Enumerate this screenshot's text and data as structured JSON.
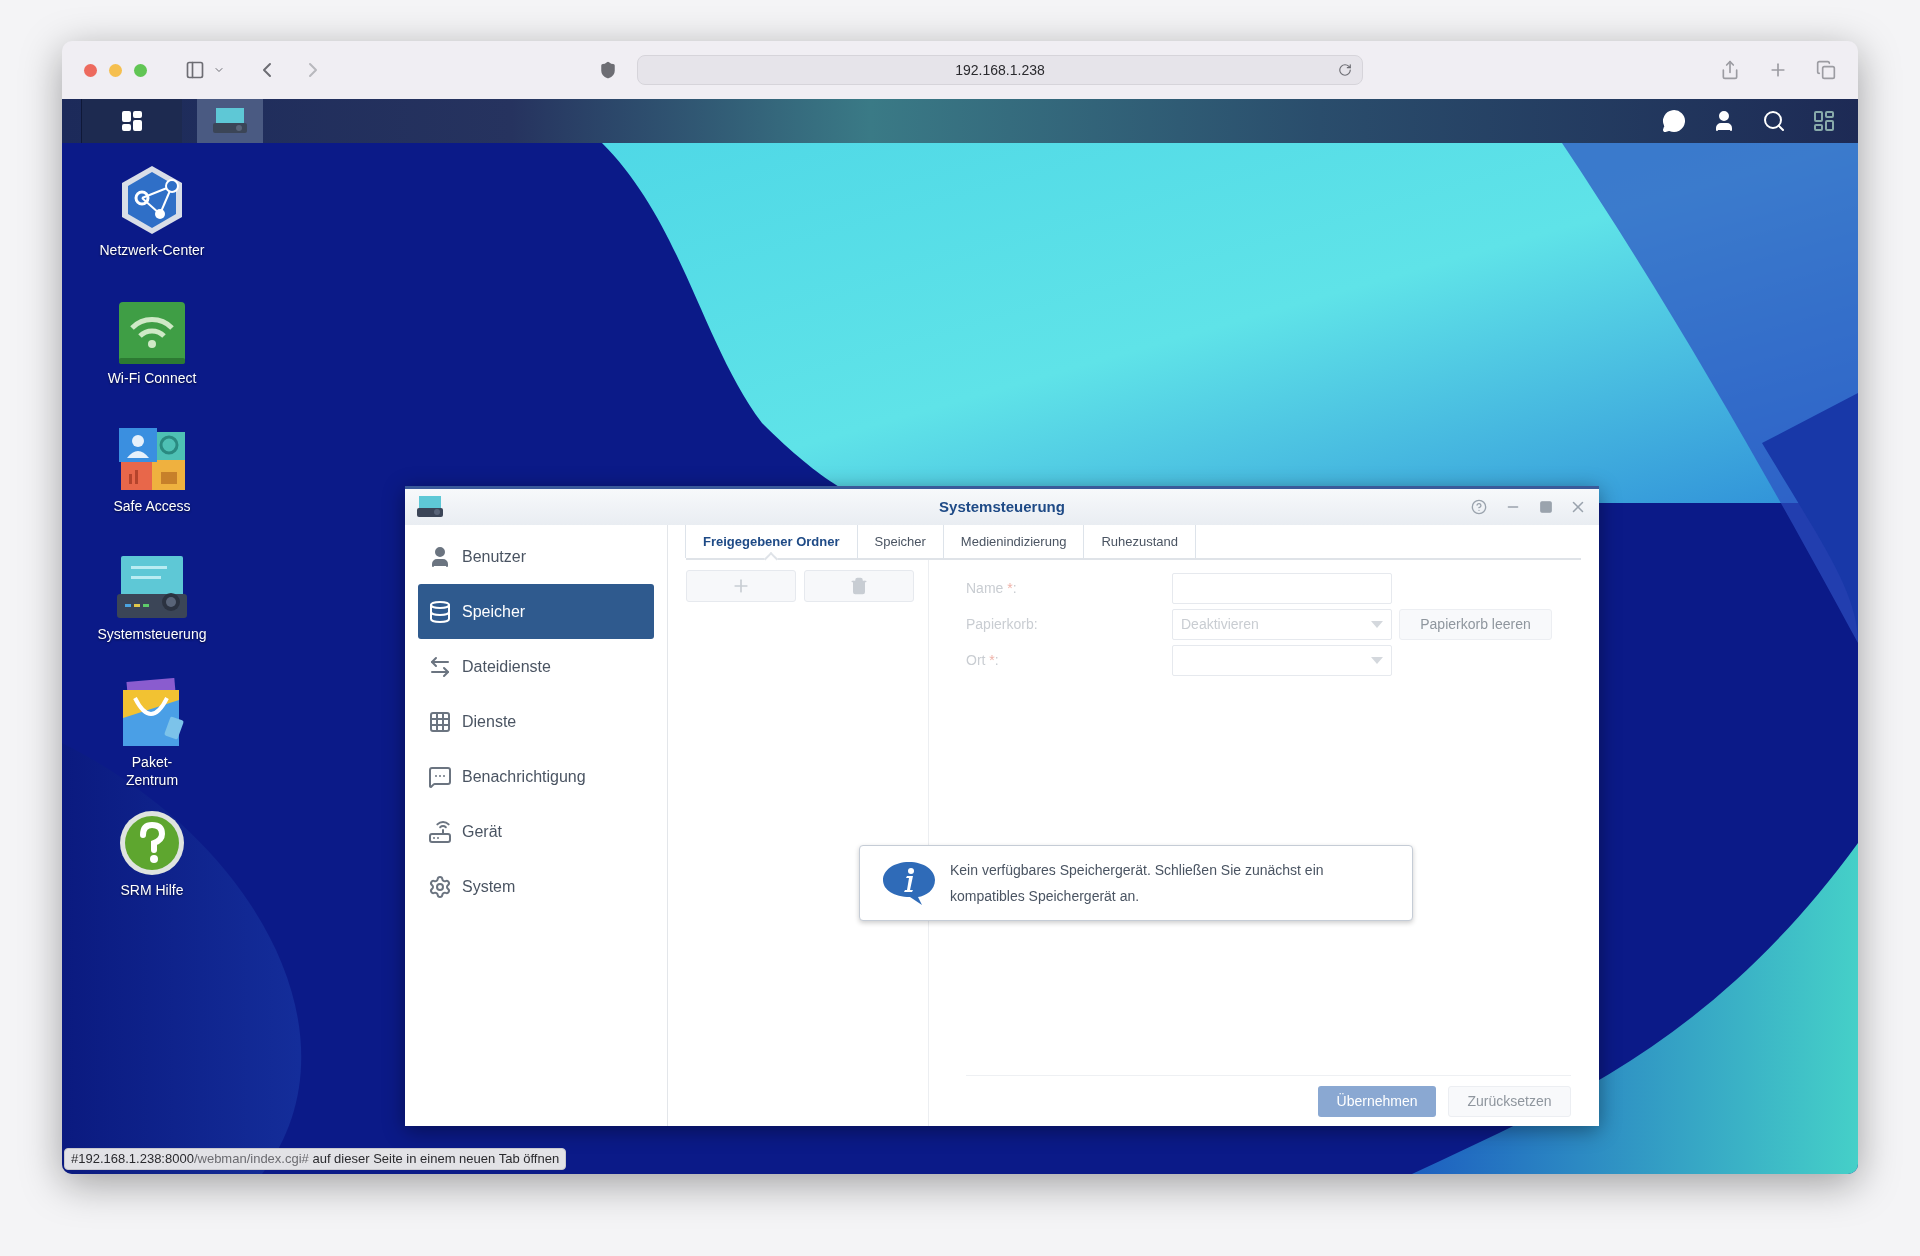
{
  "browser": {
    "url": "192.168.1.238"
  },
  "desktop_icons": [
    {
      "kind": "network",
      "label": "Netzwerk-Center"
    },
    {
      "kind": "wifi",
      "label": "Wi-Fi Connect"
    },
    {
      "kind": "safe",
      "label": "Safe Access"
    },
    {
      "kind": "control",
      "label": "Systemsteuerung"
    },
    {
      "kind": "package",
      "label": "Paket-\nZentrum"
    },
    {
      "kind": "help",
      "label": "SRM Hilfe"
    }
  ],
  "window": {
    "title": "Systemsteuerung",
    "sidebar": [
      {
        "kind": "user",
        "label": "Benutzer",
        "selected": false
      },
      {
        "kind": "storage",
        "label": "Speicher",
        "selected": true
      },
      {
        "kind": "files",
        "label": "Dateidienste",
        "selected": false
      },
      {
        "kind": "services",
        "label": "Dienste",
        "selected": false
      },
      {
        "kind": "notify",
        "label": "Benachrichtigung",
        "selected": false
      },
      {
        "kind": "device",
        "label": "Gerät",
        "selected": false
      },
      {
        "kind": "system",
        "label": "System",
        "selected": false
      }
    ],
    "tabs": [
      {
        "label": "Freigegebener Ordner",
        "selected": true
      },
      {
        "label": "Speicher",
        "selected": false
      },
      {
        "label": "Medienindizierung",
        "selected": false
      },
      {
        "label": "Ruhezustand",
        "selected": false
      }
    ],
    "disabled": true,
    "form": [
      {
        "label": "Name ",
        "mark": "*",
        "suffix": ":",
        "kind": "text"
      },
      {
        "label": "Papierkorb:",
        "kind": "select",
        "value": "Deaktivieren",
        "button": "Papierkorb leeren"
      },
      {
        "label": "Ort ",
        "mark": "*",
        "suffix": ":",
        "kind": "select"
      }
    ],
    "message": "Kein verfügbares Speichergerät. Schließen Sie zunächst ein kompatibles Speichergerät an.",
    "buttons": [
      {
        "label": "Übernehmen",
        "primary": true
      },
      {
        "label": "Zurücksetzen",
        "primary": false
      }
    ]
  },
  "status_link": [
    {
      "text": "#192.168.1.238:8000",
      "dim": false
    },
    {
      "text": "/webman/index.cgi#",
      "dim": true
    },
    {
      "text": " auf dieser Seite in einem neuen Tab öffnen",
      "dim": false
    }
  ]
}
